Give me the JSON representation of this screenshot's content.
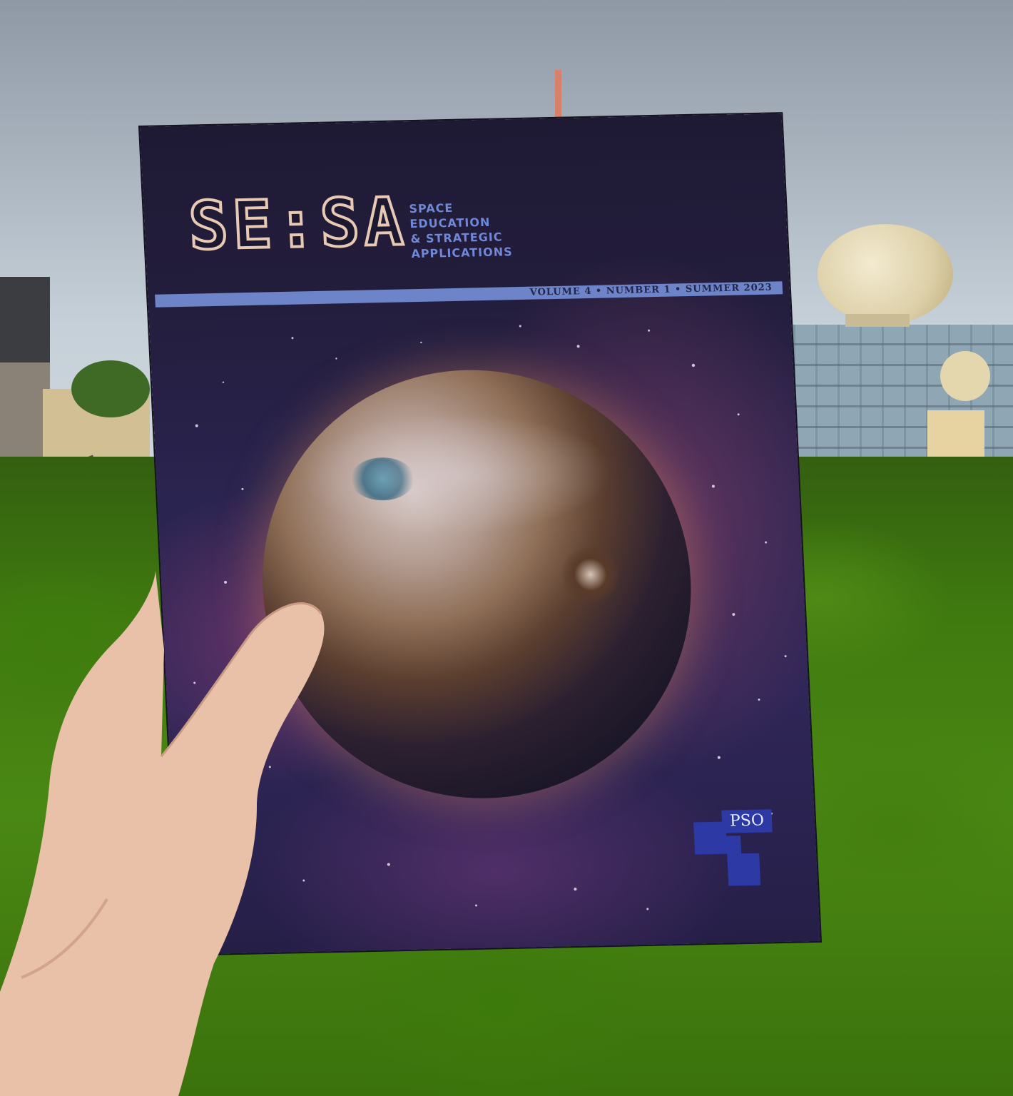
{
  "cover": {
    "logo_text": "SE:SA",
    "subtitle_lines": [
      "SPACE",
      "EDUCATION",
      "& STRATEGIC",
      "APPLICATIONS"
    ],
    "issue_line": "VOLUME 4 • NUMBER 1 • SUMMER 2023",
    "publisher_logo": "PSO"
  },
  "colors": {
    "title_outline": "#e8c9b4",
    "subtitle": "#6f88d8",
    "band": "#6d84c8",
    "publisher_blue": "#2d3aa6",
    "foliage": "#4a8814",
    "sky": "#c6d0d8"
  }
}
